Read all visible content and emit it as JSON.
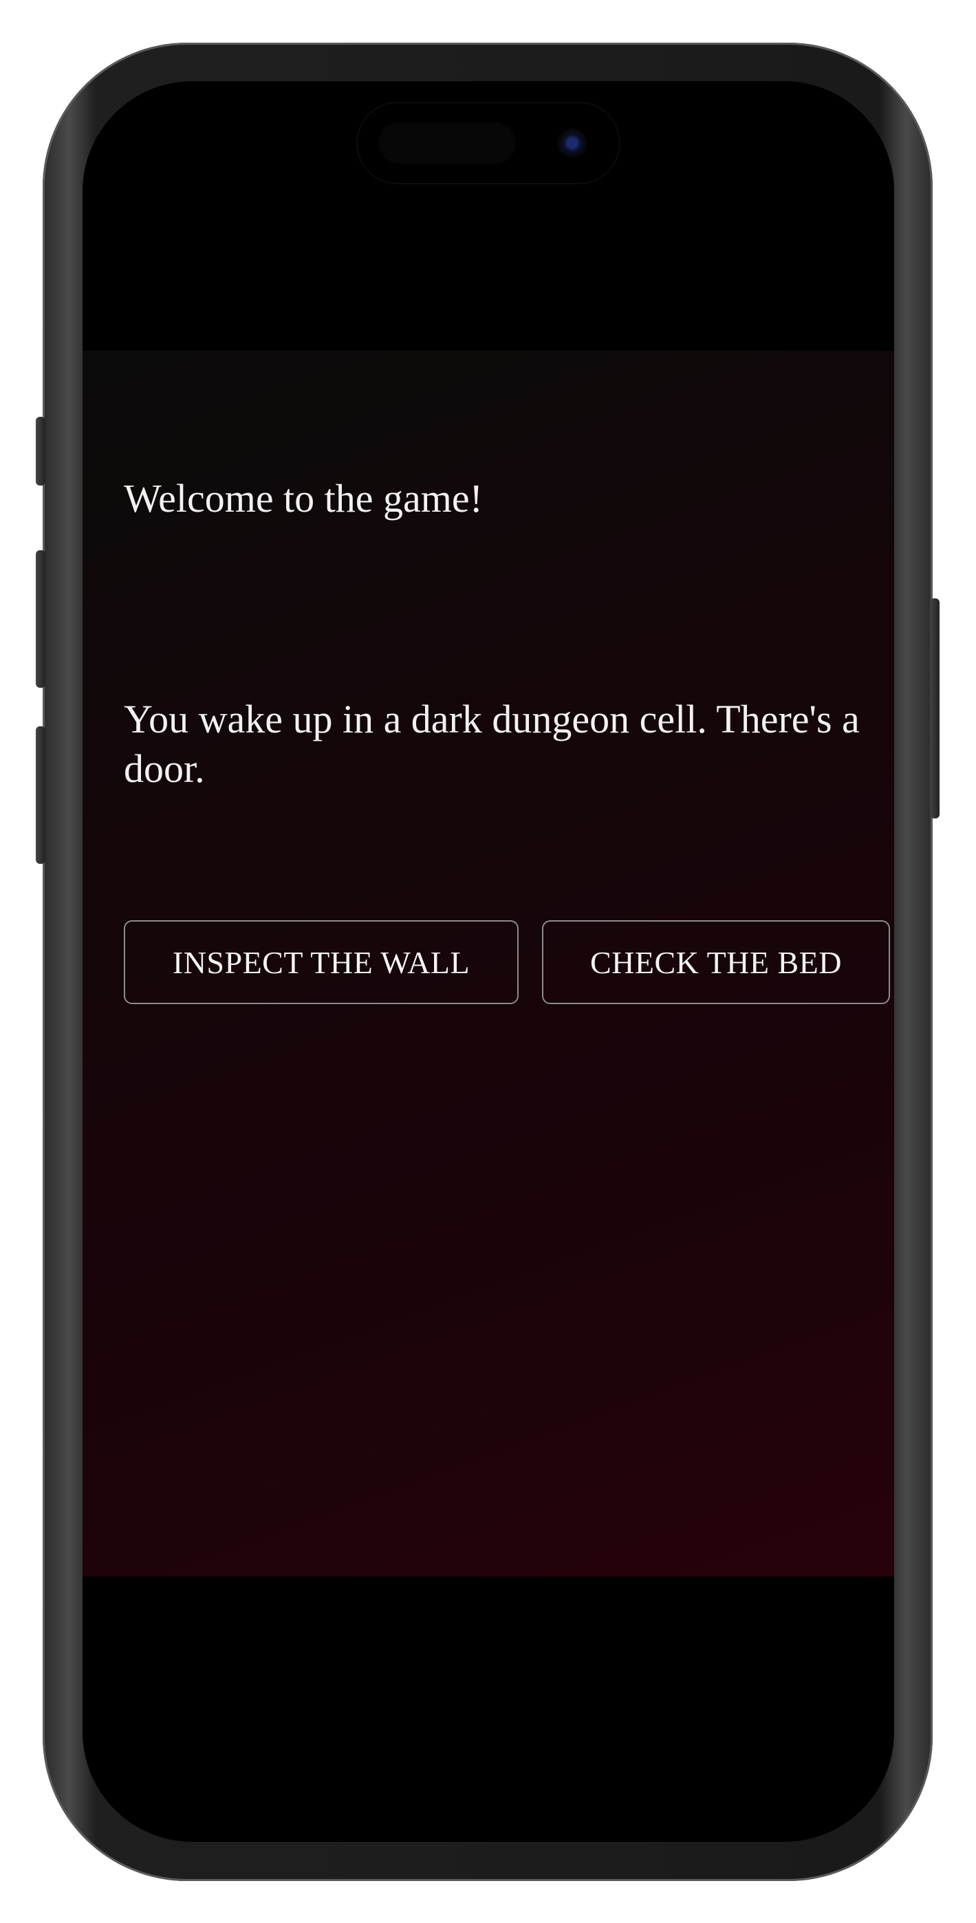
{
  "game": {
    "welcome_text": "Welcome to the game!",
    "story_text": "You wake up in a dark dungeon cell. There's a door.",
    "choices": [
      {
        "label": "INSPECT THE WALL"
      },
      {
        "label": "CHECK THE BED"
      }
    ]
  },
  "colors": {
    "background_dark": "#0b0b0b",
    "background_red": "#27020c",
    "text": "#f2f2f2",
    "button_border": "#8c8c8c"
  }
}
